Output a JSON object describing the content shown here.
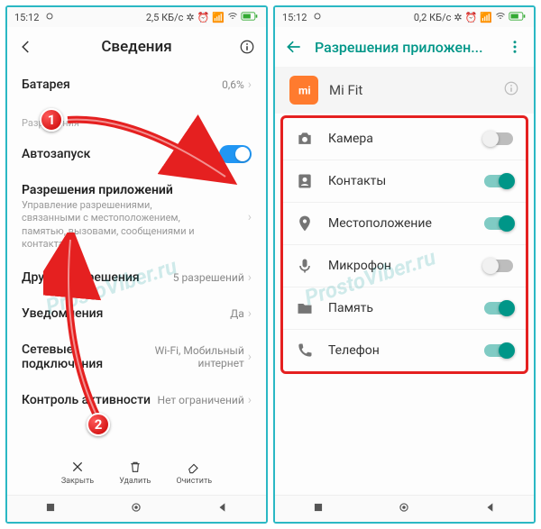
{
  "left": {
    "statusbar": {
      "time": "15:12",
      "net": "2,5 КБ/с"
    },
    "header": {
      "title": "Сведения"
    },
    "battery": {
      "label": "Батарея",
      "value": "0,6%"
    },
    "section_perm": "Разрешения",
    "autostart": {
      "label": "Автозапуск"
    },
    "app_perm": {
      "label": "Разрешения приложений",
      "desc": "Управление разрешениями, связанными с местоположением, памятью, вызовами, сообщениями и контактами"
    },
    "other_perm": {
      "label": "Другие разрешения",
      "value": "5 разрешений"
    },
    "notifications": {
      "label": "Уведомления",
      "value": "Да"
    },
    "net_conn": {
      "label": "Сетевые подключения",
      "value": "Wi-Fi, Мобильный интернет"
    },
    "activity": {
      "label": "Контроль активности",
      "value": "Нет ограничений"
    },
    "actions": {
      "close": "Закрыть",
      "delete": "Удалить",
      "clear": "Очистить"
    }
  },
  "right": {
    "statusbar": {
      "time": "15:12",
      "net": "0,2 КБ/с"
    },
    "header": {
      "title": "Разрешения приложен..."
    },
    "app": {
      "name": "Mi Fit"
    },
    "perms": [
      {
        "icon": "camera",
        "label": "Камера",
        "on": false
      },
      {
        "icon": "contacts",
        "label": "Контакты",
        "on": true
      },
      {
        "icon": "location",
        "label": "Местоположение",
        "on": true
      },
      {
        "icon": "mic",
        "label": "Микрофон",
        "on": false
      },
      {
        "icon": "storage",
        "label": "Память",
        "on": true
      },
      {
        "icon": "phone",
        "label": "Телефон",
        "on": true
      }
    ]
  },
  "watermark": "ProstoViber.ru",
  "annotations": {
    "b1": "1",
    "b2": "2"
  }
}
